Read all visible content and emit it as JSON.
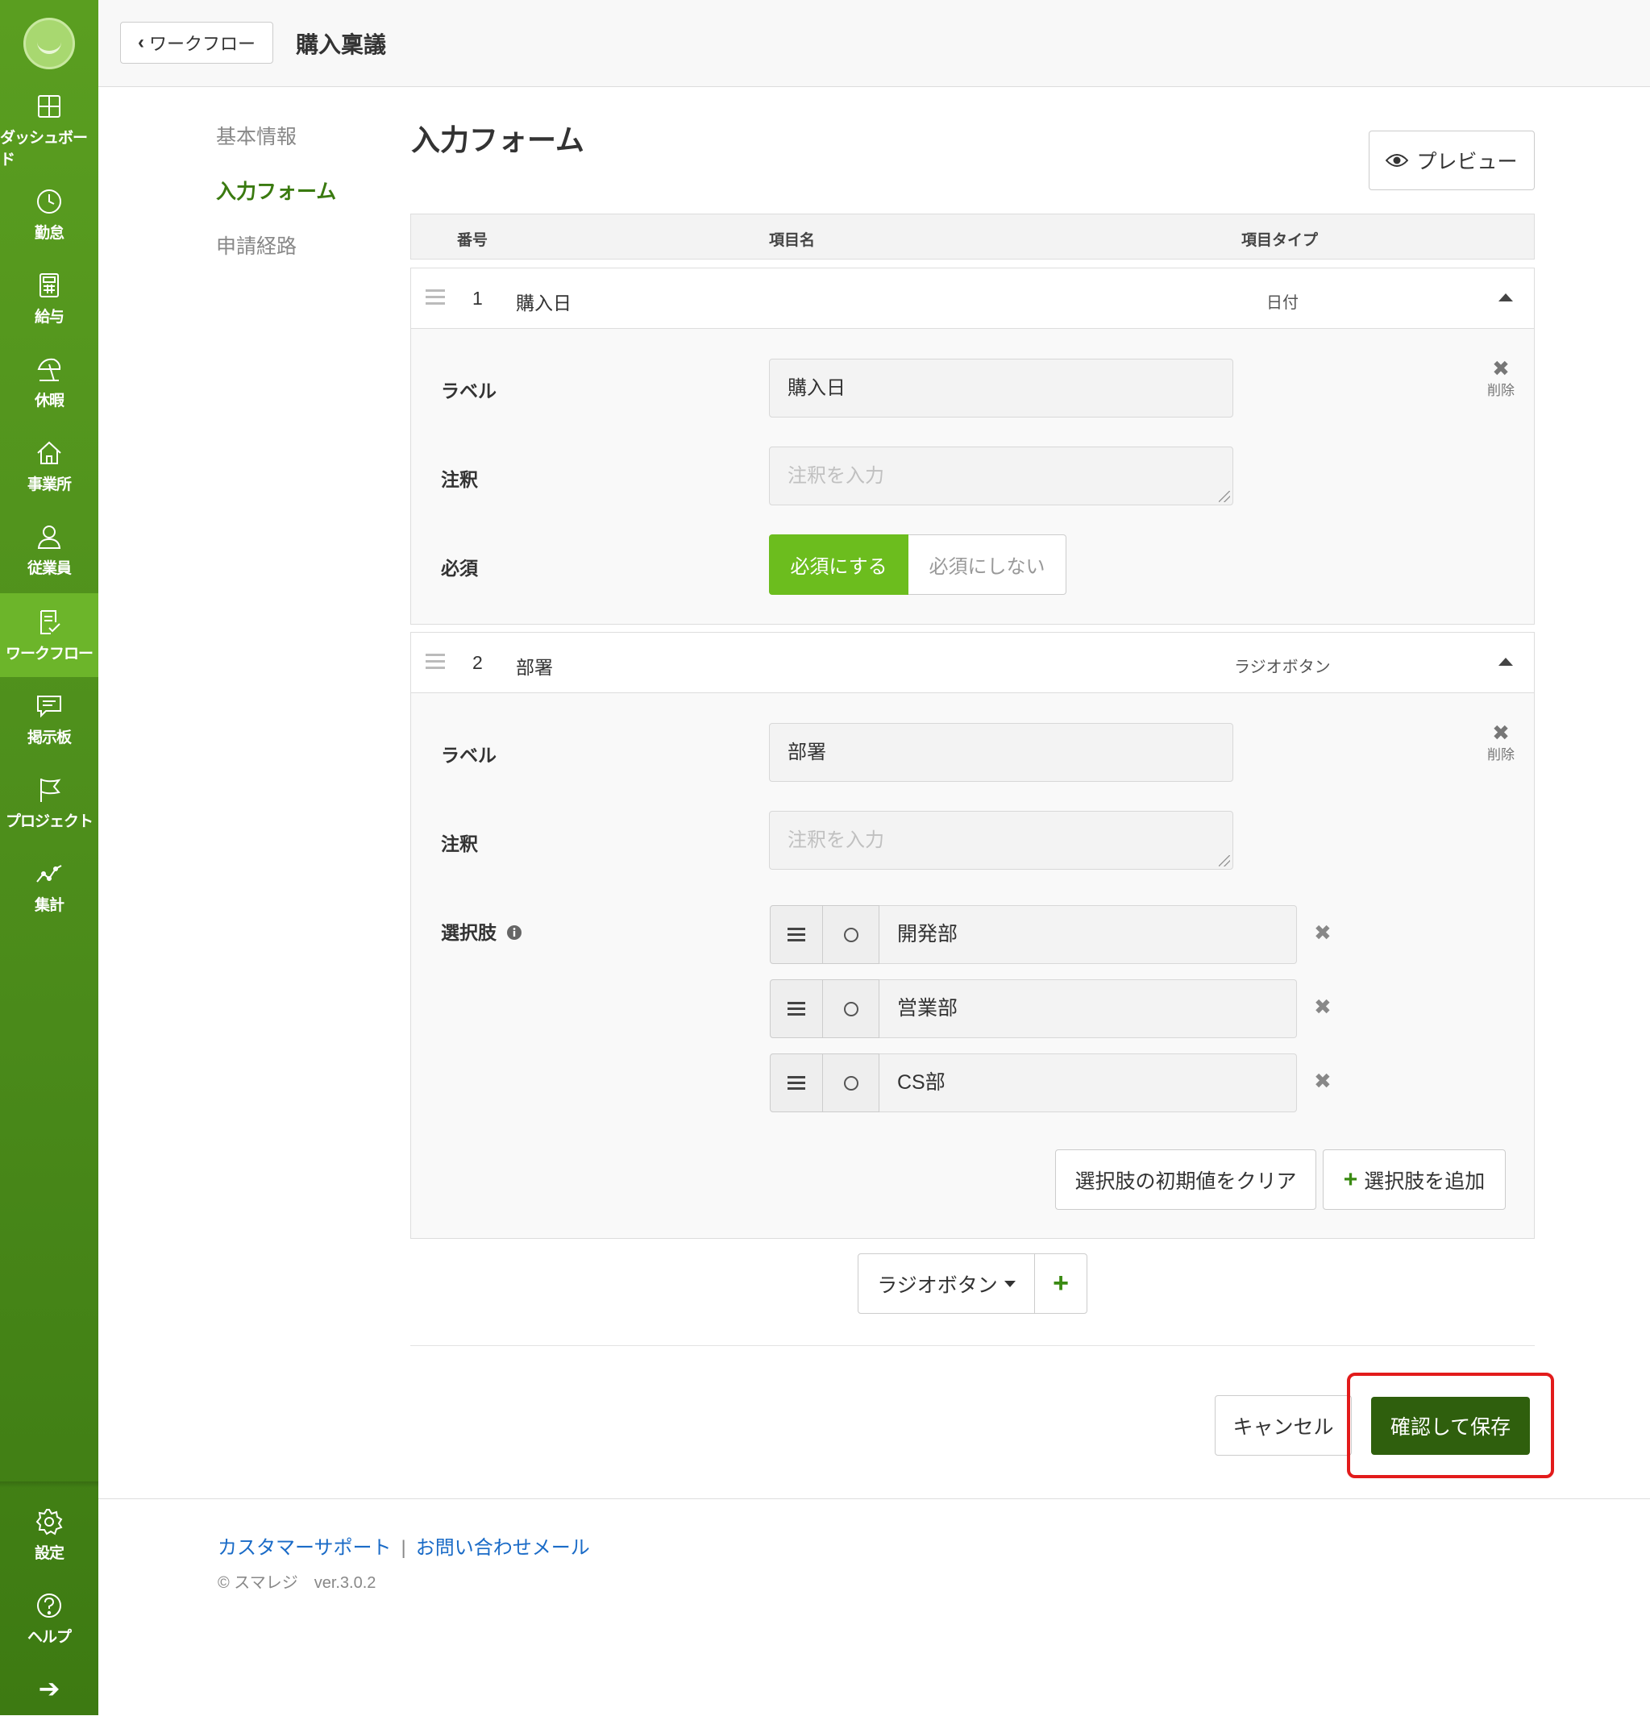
{
  "sidebar": {
    "items": [
      {
        "label": "ダッシュボード",
        "icon": "dashboard-icon"
      },
      {
        "label": "勤怠",
        "icon": "clock-icon"
      },
      {
        "label": "給与",
        "icon": "calculator-icon"
      },
      {
        "label": "休暇",
        "icon": "beach-umbrella-icon"
      },
      {
        "label": "事業所",
        "icon": "home-icon"
      },
      {
        "label": "従業員",
        "icon": "person-icon"
      },
      {
        "label": "ワークフロー",
        "icon": "workflow-document-icon",
        "active": true
      },
      {
        "label": "掲示板",
        "icon": "message-board-icon"
      },
      {
        "label": "プロジェクト",
        "icon": "flag-icon"
      },
      {
        "label": "集計",
        "icon": "line-chart-icon"
      }
    ],
    "bottom_items": [
      {
        "label": "設定",
        "icon": "gear-icon"
      },
      {
        "label": "ヘルプ",
        "icon": "help-icon"
      }
    ],
    "expand_icon": "arrow-right-icon"
  },
  "header": {
    "back_label": "ワークフロー",
    "title": "購入稟議"
  },
  "subnav": {
    "items": [
      "基本情報",
      "入力フォーム",
      "申請経路"
    ],
    "active_index": 1
  },
  "main": {
    "section_title": "入力フォーム",
    "preview_label": "プレビュー",
    "table_headers": {
      "number": "番号",
      "name": "項目名",
      "type": "項目タイプ"
    },
    "items": [
      {
        "number": "1",
        "name": "購入日",
        "type": "日付",
        "label_caption": "ラベル",
        "label_value": "購入日",
        "note_caption": "注釈",
        "note_placeholder": "注釈を入力",
        "required_caption": "必須",
        "required_on": "必須にする",
        "required_off": "必須にしない",
        "delete_label": "削除"
      },
      {
        "number": "2",
        "name": "部署",
        "type": "ラジオボタン",
        "label_caption": "ラベル",
        "label_value": "部署",
        "note_caption": "注釈",
        "note_placeholder": "注釈を入力",
        "options_caption": "選択肢",
        "options": [
          "開発部",
          "営業部",
          "CS部"
        ],
        "clear_default_label": "選択肢の初期値をクリア",
        "add_option_label": "選択肢を追加",
        "delete_label": "削除"
      }
    ],
    "add_type_select": "ラジオボタン",
    "cancel_label": "キャンセル",
    "save_label": "確認して保存"
  },
  "footer": {
    "support_link": "カスタマーサポート",
    "separator": "|",
    "contact_link": "お問い合わせメール",
    "copyright": "© スマレジ　ver.3.0.2"
  },
  "colors": {
    "sidebar": "#4a8a1a",
    "sidebar_active": "#6cb52a",
    "required_on": "#6cbd1e",
    "save_button": "#2f5f0d",
    "highlight": "#e21b1b",
    "link": "#1a6bc7"
  }
}
